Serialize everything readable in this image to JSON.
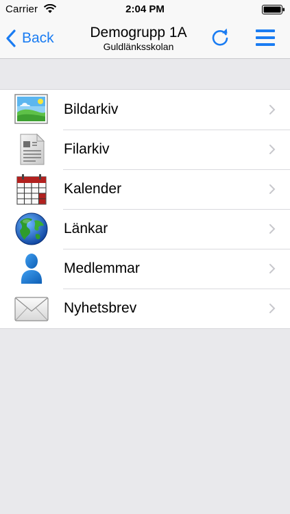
{
  "status_bar": {
    "carrier": "Carrier",
    "time": "2:04 PM"
  },
  "nav": {
    "back_label": "Back",
    "title": "Demogrupp 1A",
    "subtitle": "Guldlänksskolan",
    "refresh_icon": "refresh-icon",
    "menu_icon": "hamburger-menu-icon",
    "accent_color": "#1a7cf2"
  },
  "items": [
    {
      "label": "Bildarkiv",
      "icon": "picture-icon"
    },
    {
      "label": "Filarkiv",
      "icon": "document-icon"
    },
    {
      "label": "Kalender",
      "icon": "calendar-icon"
    },
    {
      "label": "Länkar",
      "icon": "globe-icon"
    },
    {
      "label": "Medlemmar",
      "icon": "person-icon"
    },
    {
      "label": "Nyhetsbrev",
      "icon": "envelope-icon"
    }
  ]
}
